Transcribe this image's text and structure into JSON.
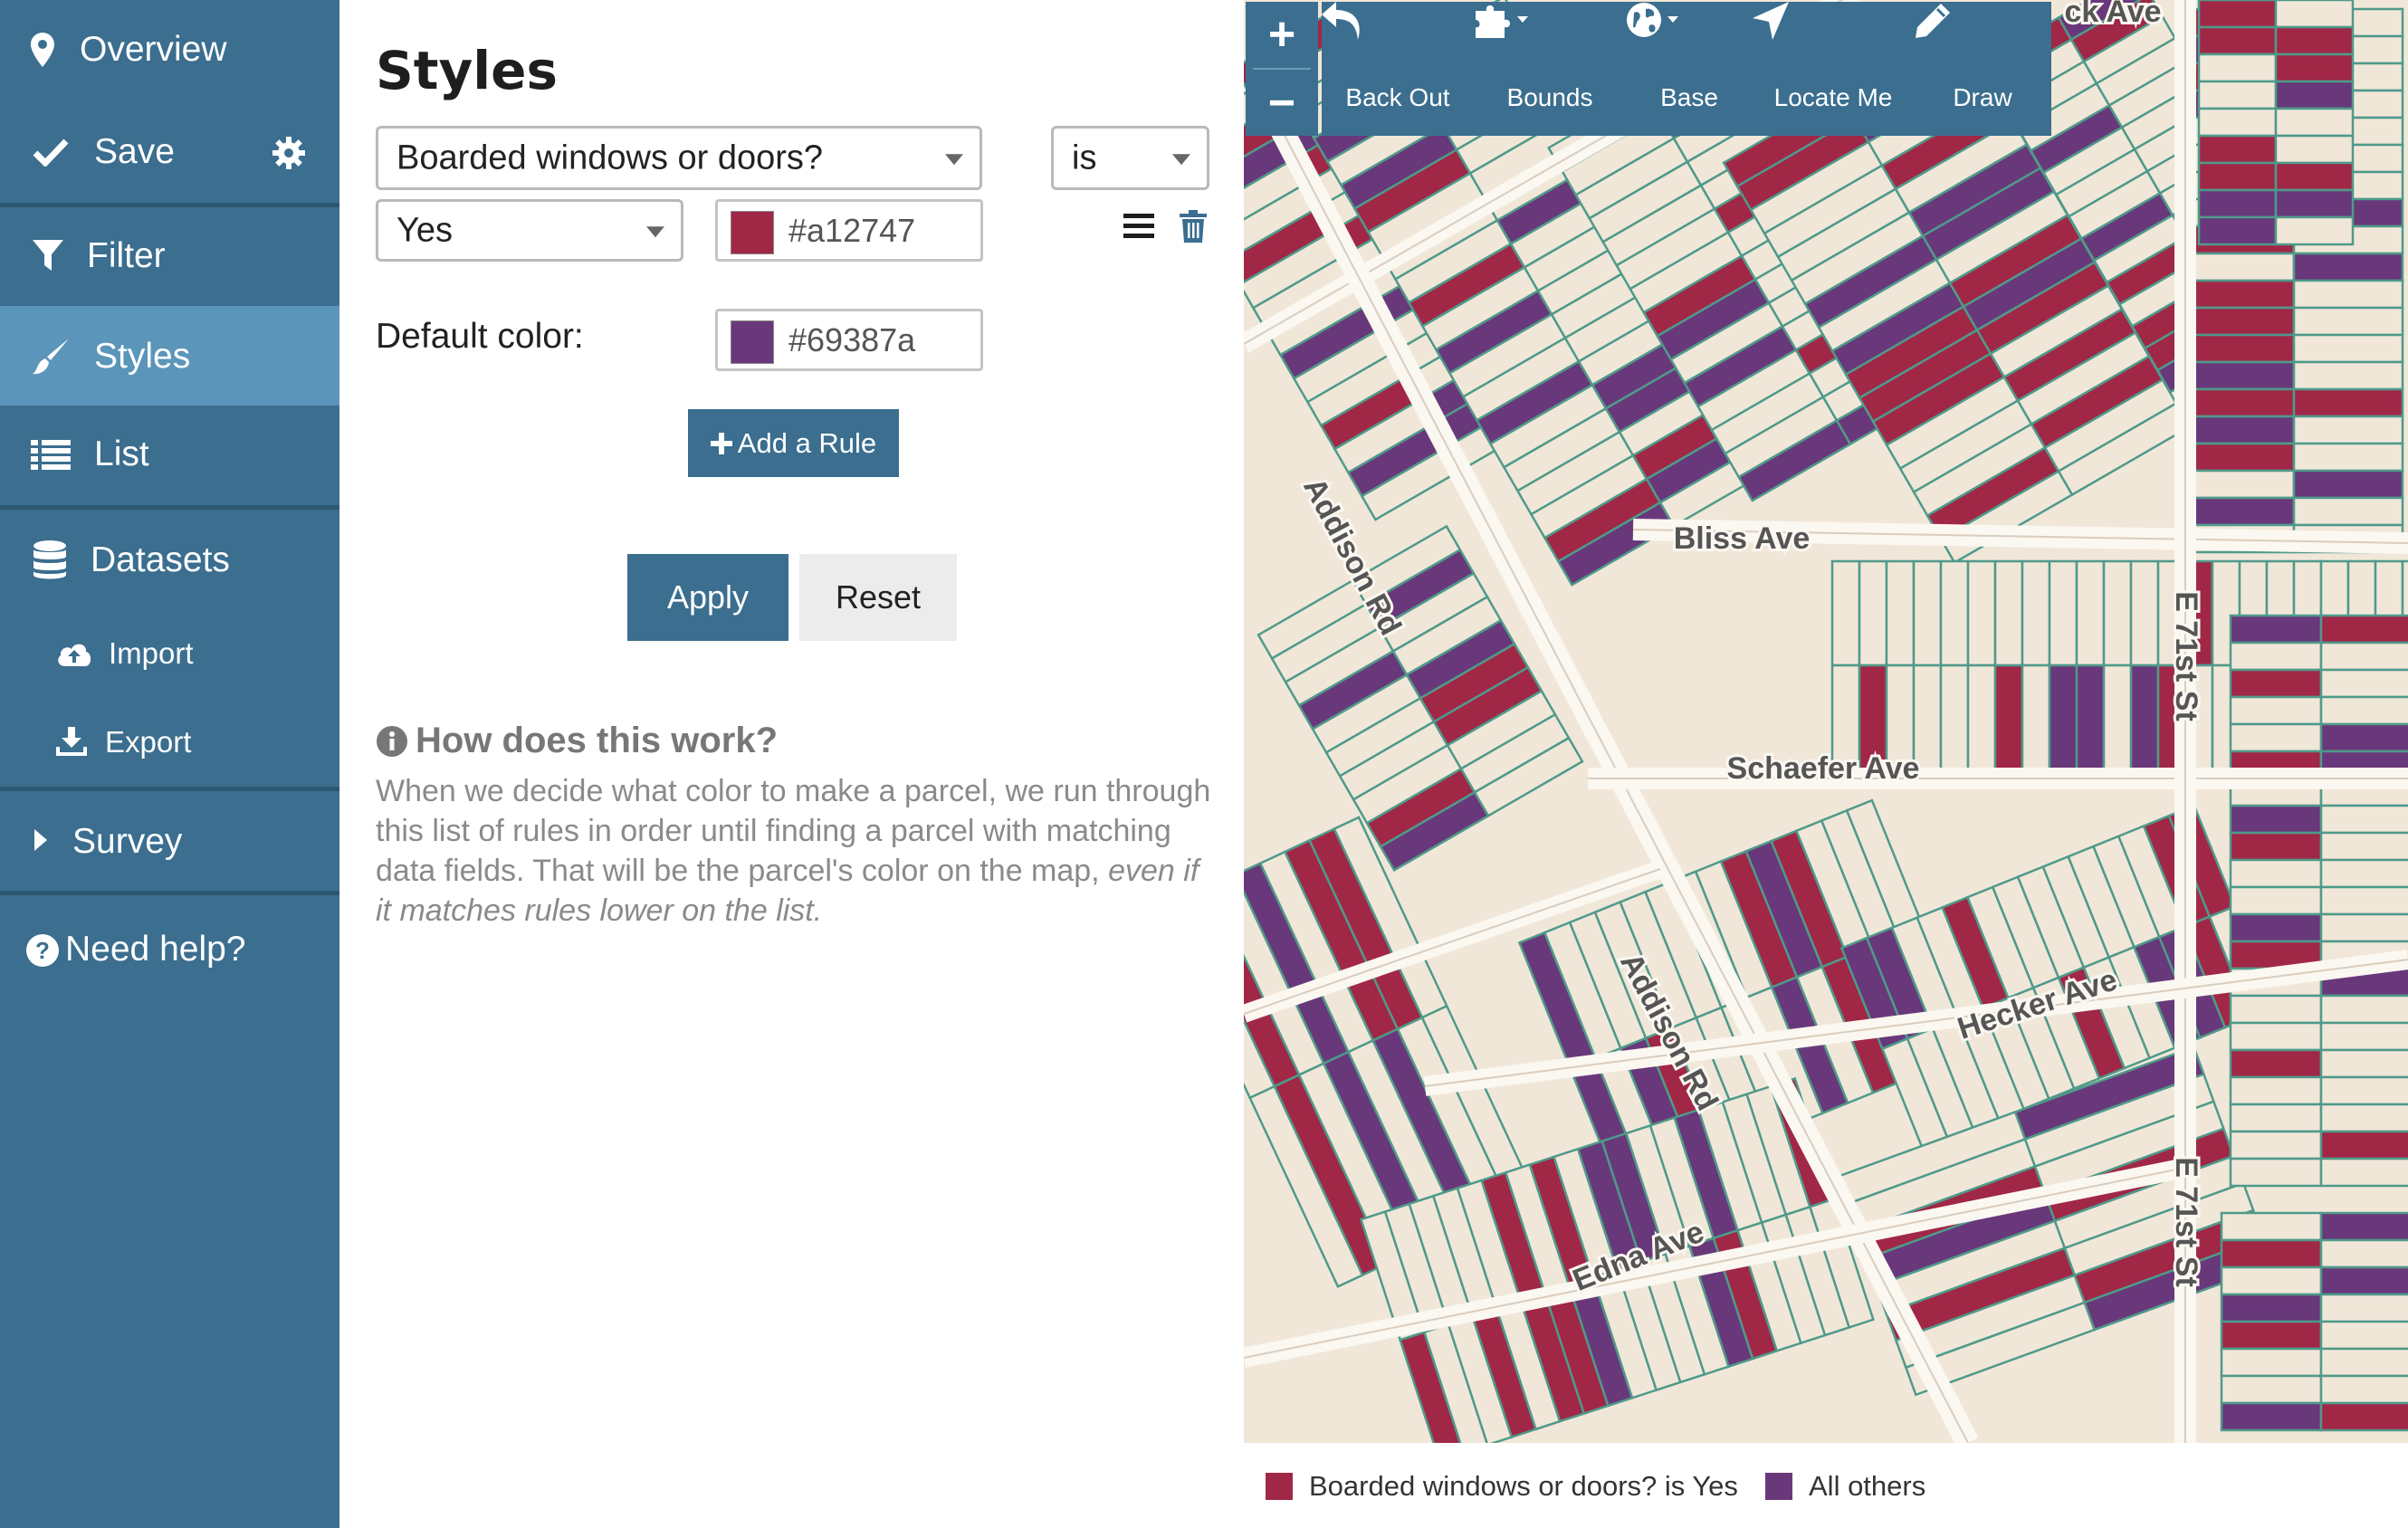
{
  "sidebar": {
    "items": [
      {
        "label": "Overview",
        "icon": "map-marker-icon"
      },
      {
        "label": "Save",
        "icon": "checkmark-icon",
        "extra_icon": "gear-icon"
      },
      {
        "label": "Filter",
        "icon": "funnel-icon"
      },
      {
        "label": "Styles",
        "icon": "paintbrush-icon",
        "active": true
      },
      {
        "label": "List",
        "icon": "list-icon"
      },
      {
        "label": "Datasets",
        "icon": "database-icon"
      },
      {
        "label": "Import",
        "icon": "cloud-upload-icon"
      },
      {
        "label": "Export",
        "icon": "download-icon"
      },
      {
        "label": "Survey",
        "icon": "caret-right-icon"
      },
      {
        "label": "Need help?",
        "icon": "question-circle-icon"
      }
    ]
  },
  "panel": {
    "title": "Styles",
    "rule": {
      "field": "Boarded windows or doors?",
      "operator": "is",
      "value": "Yes",
      "color": "#a12747"
    },
    "default_label": "Default color:",
    "default_color": "#69387a",
    "add_rule_label": "Add a Rule",
    "apply_label": "Apply",
    "reset_label": "Reset",
    "help_title": "How does this work?",
    "help_text_plain": "When we decide what color to make a parcel, we run through this list of rules in order until finding a parcel with matching data fields. That will be the parcel's color on the map,",
    "help_text_italic": "even if it matches rules lower on the list."
  },
  "map": {
    "toolbar": [
      {
        "label": "Back Out",
        "icon": "undo-arrow-icon"
      },
      {
        "label": "Bounds",
        "icon": "puzzle-icon"
      },
      {
        "label": "Base",
        "icon": "globe-icon"
      },
      {
        "label": "Locate Me",
        "icon": "location-arrow-icon"
      },
      {
        "label": "Draw",
        "icon": "pencil-icon"
      }
    ],
    "zoom_in": "+",
    "zoom_out": "−",
    "streets": [
      "ck Ave",
      "Bliss Ave",
      "Addison Rd",
      "Schaefer Ave",
      "E 71st St",
      "Addison Rd",
      "Hecker Ave",
      "Edna Ave",
      "E 71st St"
    ],
    "colors": {
      "base": "#f1e7d9",
      "rule": "#a12747",
      "default": "#69387a",
      "parcel_line": "#4f9a8a",
      "road": "#fbf7f1"
    }
  },
  "legend": [
    {
      "label": "Boarded windows or doors? is Yes",
      "color": "#a12747"
    },
    {
      "label": "All others",
      "color": "#69387a"
    }
  ]
}
